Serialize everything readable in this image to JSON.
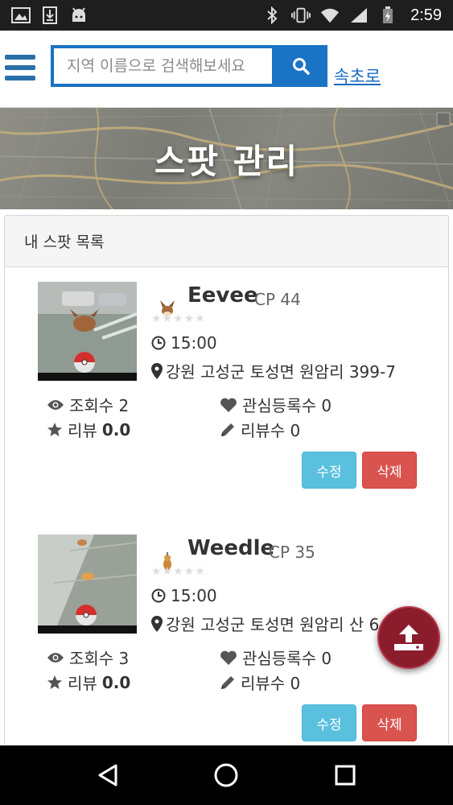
{
  "status_bar": {
    "time": "2:59",
    "left_icons": [
      "gallery-icon",
      "download-icon",
      "android-icon"
    ],
    "right_icons": [
      "bluetooth-icon",
      "vibrate-icon",
      "wifi-icon",
      "signal-icon",
      "battery-icon"
    ]
  },
  "header": {
    "search_placeholder": "지역 이름으로 검색해보세요",
    "shortcut_label": "속초로"
  },
  "hero": {
    "title": "스팟 관리"
  },
  "panel": {
    "heading": "내 스팟 목록"
  },
  "spots": [
    {
      "name": "Eevee",
      "cp": "CP 44",
      "rating_stars": "★★★★★",
      "time": "15:00",
      "address": "강원 고성군 토성면 원암리 399-7",
      "views_label": "조회수 2",
      "favorites_label": "관심등록수 0",
      "review_label": "리뷰",
      "review_score": "0.0",
      "review_count_label": "리뷰수 0",
      "edit_label": "수정",
      "delete_label": "삭제"
    },
    {
      "name": "Weedle",
      "cp": "CP 35",
      "rating_stars": "★★★★★",
      "time": "15:00",
      "address": "강원 고성군 토성면 원암리 산 6",
      "views_label": "조회수 3",
      "favorites_label": "관심등록수 0",
      "review_label": "리뷰",
      "review_score": "0.0",
      "review_count_label": "리뷰수 0",
      "edit_label": "수정",
      "delete_label": "삭제"
    }
  ],
  "colors": {
    "brand_blue": "#1a73c4",
    "edit_button": "#5bc0de",
    "delete_button": "#d9534f",
    "fab": "#8b1c2c"
  }
}
